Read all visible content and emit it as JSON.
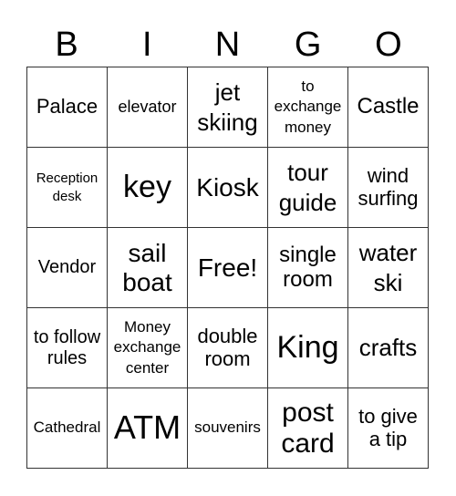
{
  "header": [
    "B",
    "I",
    "N",
    "G",
    "O"
  ],
  "cells": [
    "Palace",
    "elevator",
    "jet skiing",
    "to exchange money",
    "Castle",
    "Reception desk",
    "key",
    "Kiosk",
    "tour guide",
    "wind surfing",
    "Vendor",
    "sail boat",
    "Free!",
    "single room",
    "water ski",
    "to follow rules",
    "Money exchange center",
    "double room",
    "King",
    "crafts",
    "Cathedral",
    "ATM",
    "souvenirs",
    "post card",
    "to give a tip"
  ]
}
